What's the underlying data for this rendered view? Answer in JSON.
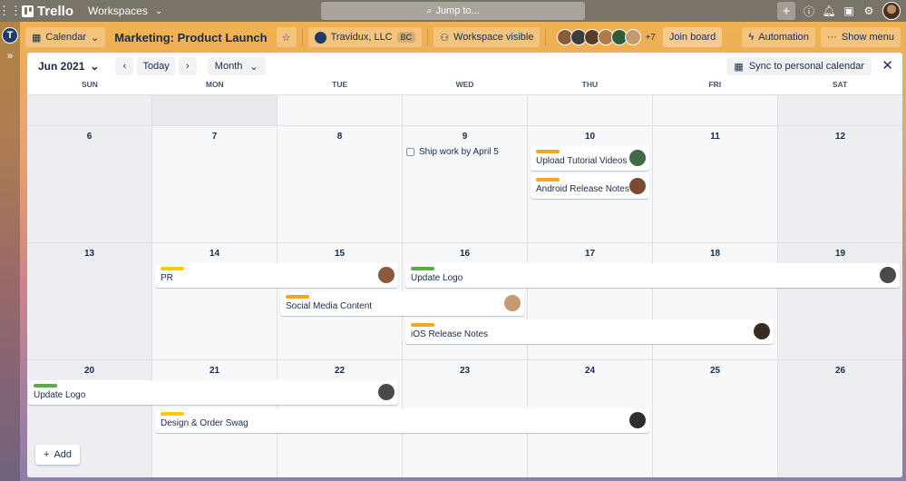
{
  "topbar": {
    "app_name": "Trello",
    "workspaces_label": "Workspaces",
    "jump_placeholder": "Jump to..."
  },
  "rail": {
    "workspace_initial": "T"
  },
  "board": {
    "view_label": "Calendar",
    "title": "Marketing: Product Launch",
    "workspace_name": "Travidux, LLC",
    "workspace_tag": "BC",
    "visibility_label": "Workspace visible",
    "members_more": "+7",
    "join_label": "Join board",
    "automation_label": "Automation",
    "show_menu_label": "Show menu"
  },
  "calendar": {
    "month_label": "Jun 2021",
    "today_label": "Today",
    "view_mode": "Month",
    "sync_label": "Sync to personal calendar",
    "weekdays": [
      "SUN",
      "MON",
      "TUE",
      "WED",
      "THU",
      "FRI",
      "SAT"
    ],
    "weeks": [
      [
        "",
        "",
        "",
        "",
        "",
        "",
        ""
      ],
      [
        "6",
        "7",
        "8",
        "9",
        "10",
        "11",
        "12"
      ],
      [
        "13",
        "14",
        "15",
        "16",
        "17",
        "18",
        "19"
      ],
      [
        "20",
        "21",
        "22",
        "23",
        "24",
        "25",
        "26"
      ]
    ],
    "checklist_item": "Ship work by April 5",
    "cards": [
      {
        "title": "Upload Tutorial Videos",
        "label_color": "#f5a623"
      },
      {
        "title": "Android Release Notes",
        "label_color": "#f5a623"
      },
      {
        "title": "PR",
        "label_color": "#f5cd00"
      },
      {
        "title": "Update Logo",
        "label_color": "#5aac44"
      },
      {
        "title": "Social Media Content",
        "label_color": "#f5a623"
      },
      {
        "title": "iOS Release Notes",
        "label_color": "#f5a623"
      },
      {
        "title": "Update Logo",
        "label_color": "#5aac44"
      },
      {
        "title": "Design & Order Swag",
        "label_color": "#f5cd00"
      }
    ],
    "add_label": "Add"
  }
}
